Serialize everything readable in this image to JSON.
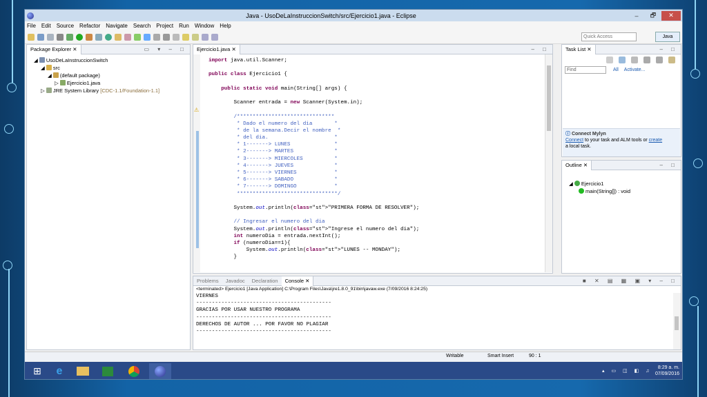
{
  "window": {
    "title": "Java - UsoDeLaInstruccionSwitch/src/Ejercicio1.java - Eclipse",
    "minimize": "–",
    "maximize": "🗗",
    "close": "✕"
  },
  "menu": [
    "File",
    "Edit",
    "Source",
    "Refactor",
    "Navigate",
    "Search",
    "Project",
    "Run",
    "Window",
    "Help"
  ],
  "toolbar": {
    "quick_access_placeholder": "Quick Access",
    "perspective": "Java"
  },
  "package_explorer": {
    "tab": "Package Explorer ✕",
    "tree": [
      "UsoDeLaInstruccionSwitch",
      "src",
      "(default package)",
      "Ejercicio1.java",
      "JRE System Library"
    ],
    "jre_suffix": "[CDC-1.1/Foundation-1.1]"
  },
  "editor": {
    "tab": "Ejercicio1.java ✕",
    "lines": [
      [
        "import java.util.Scanner;"
      ],
      [
        ""
      ],
      [
        "public class Ejercicio1 {"
      ],
      [
        ""
      ],
      [
        "    public static void main(String[] args) {"
      ],
      [
        ""
      ],
      [
        "        Scanner entrada = new Scanner(System.in);"
      ],
      [
        ""
      ],
      [
        "        /*******************************"
      ],
      [
        "         * Dado el numero del dia       *"
      ],
      [
        "         * de la semana.Decir el nombre  *"
      ],
      [
        "         * del dia.                     *"
      ],
      [
        "         * 1-------> LUNES              *"
      ],
      [
        "         * 2-------> MARTES             *"
      ],
      [
        "         * 3-------> MIERCOLES          *"
      ],
      [
        "         * 4-------> JUEVES             *"
      ],
      [
        "         * 5-------> VIERNES            *"
      ],
      [
        "         * 6-------> SABADO             *"
      ],
      [
        "         * 7-------> DOMINGO            *"
      ],
      [
        "         ********************************/"
      ],
      [
        ""
      ],
      [
        "        System.out.println(\"PRIMERA FORMA DE RESOLVER\");"
      ],
      [
        ""
      ],
      [
        "        // Ingresar el numero del dia"
      ],
      [
        "        System.out.println(\"Ingrese el numero del dia\");"
      ],
      [
        "        int numeroDia = entrada.nextInt();"
      ],
      [
        "        if (numeroDia==1){"
      ],
      [
        "            System.out.println(\"LUNES -- MONDAY\");"
      ],
      [
        "        }"
      ]
    ]
  },
  "task_list": {
    "tab": "Task List ✕",
    "find_placeholder": "Find",
    "filter_all": "All",
    "activate": "Activate..."
  },
  "mylyn": {
    "title": "Connect Mylyn",
    "link1": "Connect",
    "text1": " to your task and ALM tools or ",
    "link2": "create",
    "text2": "a local task."
  },
  "outline": {
    "tab": "Outline ✕",
    "class": "Ejercicio1",
    "method": "main(String[]) : void"
  },
  "bottom_tabs": [
    "Problems",
    "Javadoc",
    "Declaration",
    "Console ✕"
  ],
  "console": {
    "header": "<terminated> Ejercicio1 [Java Application] C:\\Program Files\\Java\\jre1.8.0_91\\bin\\javaw.exe (7/09/2016 8:24:25)",
    "lines": [
      "VIERNES",
      "-------------------------------------------",
      "GRACIAS POR USAR NUESTRO PROGRAMA",
      "-------------------------------------------",
      "DERECHOS DE AUTOR ... POR FAVOR NO PLAGIAR",
      "-------------------------------------------"
    ]
  },
  "status": {
    "writable": "Writable",
    "insert": "Smart Insert",
    "position": "90 : 1"
  },
  "taskbar": {
    "time": "8:29 a. m.",
    "date": "07/09/2016"
  },
  "colors": {
    "title_bg": "#cbdcee",
    "taskbar": "#2a4a88",
    "close": "#c7504a",
    "keyword": "#7f0055",
    "comment": "#3f5fbf",
    "string": "#2a00ff"
  }
}
